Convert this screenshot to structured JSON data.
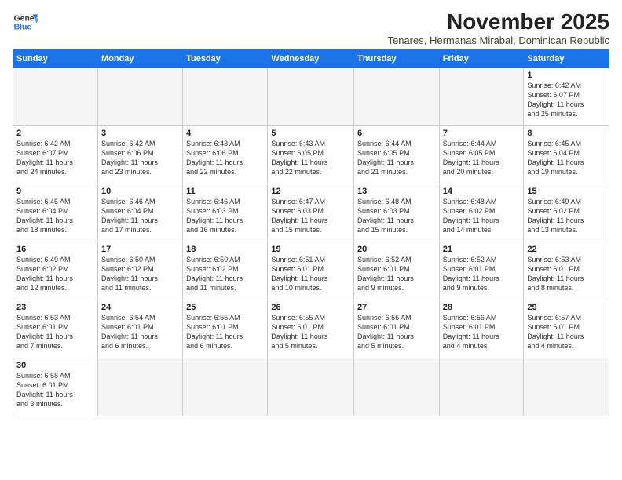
{
  "logo": {
    "line1": "General",
    "line2": "Blue"
  },
  "title": "November 2025",
  "subtitle": "Tenares, Hermanas Mirabal, Dominican Republic",
  "days_of_week": [
    "Sunday",
    "Monday",
    "Tuesday",
    "Wednesday",
    "Thursday",
    "Friday",
    "Saturday"
  ],
  "weeks": [
    [
      {
        "day": "",
        "info": ""
      },
      {
        "day": "",
        "info": ""
      },
      {
        "day": "",
        "info": ""
      },
      {
        "day": "",
        "info": ""
      },
      {
        "day": "",
        "info": ""
      },
      {
        "day": "",
        "info": ""
      },
      {
        "day": "1",
        "info": "Sunrise: 6:42 AM\nSunset: 6:07 PM\nDaylight: 11 hours\nand 25 minutes."
      }
    ],
    [
      {
        "day": "2",
        "info": "Sunrise: 6:42 AM\nSunset: 6:07 PM\nDaylight: 11 hours\nand 24 minutes."
      },
      {
        "day": "3",
        "info": "Sunrise: 6:42 AM\nSunset: 6:06 PM\nDaylight: 11 hours\nand 23 minutes."
      },
      {
        "day": "4",
        "info": "Sunrise: 6:43 AM\nSunset: 6:06 PM\nDaylight: 11 hours\nand 22 minutes."
      },
      {
        "day": "5",
        "info": "Sunrise: 6:43 AM\nSunset: 6:05 PM\nDaylight: 11 hours\nand 22 minutes."
      },
      {
        "day": "6",
        "info": "Sunrise: 6:44 AM\nSunset: 6:05 PM\nDaylight: 11 hours\nand 21 minutes."
      },
      {
        "day": "7",
        "info": "Sunrise: 6:44 AM\nSunset: 6:05 PM\nDaylight: 11 hours\nand 20 minutes."
      },
      {
        "day": "8",
        "info": "Sunrise: 6:45 AM\nSunset: 6:04 PM\nDaylight: 11 hours\nand 19 minutes."
      }
    ],
    [
      {
        "day": "9",
        "info": "Sunrise: 6:45 AM\nSunset: 6:04 PM\nDaylight: 11 hours\nand 18 minutes."
      },
      {
        "day": "10",
        "info": "Sunrise: 6:46 AM\nSunset: 6:04 PM\nDaylight: 11 hours\nand 17 minutes."
      },
      {
        "day": "11",
        "info": "Sunrise: 6:46 AM\nSunset: 6:03 PM\nDaylight: 11 hours\nand 16 minutes."
      },
      {
        "day": "12",
        "info": "Sunrise: 6:47 AM\nSunset: 6:03 PM\nDaylight: 11 hours\nand 15 minutes."
      },
      {
        "day": "13",
        "info": "Sunrise: 6:48 AM\nSunset: 6:03 PM\nDaylight: 11 hours\nand 15 minutes."
      },
      {
        "day": "14",
        "info": "Sunrise: 6:48 AM\nSunset: 6:02 PM\nDaylight: 11 hours\nand 14 minutes."
      },
      {
        "day": "15",
        "info": "Sunrise: 6:49 AM\nSunset: 6:02 PM\nDaylight: 11 hours\nand 13 minutes."
      }
    ],
    [
      {
        "day": "16",
        "info": "Sunrise: 6:49 AM\nSunset: 6:02 PM\nDaylight: 11 hours\nand 12 minutes."
      },
      {
        "day": "17",
        "info": "Sunrise: 6:50 AM\nSunset: 6:02 PM\nDaylight: 11 hours\nand 11 minutes."
      },
      {
        "day": "18",
        "info": "Sunrise: 6:50 AM\nSunset: 6:02 PM\nDaylight: 11 hours\nand 11 minutes."
      },
      {
        "day": "19",
        "info": "Sunrise: 6:51 AM\nSunset: 6:01 PM\nDaylight: 11 hours\nand 10 minutes."
      },
      {
        "day": "20",
        "info": "Sunrise: 6:52 AM\nSunset: 6:01 PM\nDaylight: 11 hours\nand 9 minutes."
      },
      {
        "day": "21",
        "info": "Sunrise: 6:52 AM\nSunset: 6:01 PM\nDaylight: 11 hours\nand 9 minutes."
      },
      {
        "day": "22",
        "info": "Sunrise: 6:53 AM\nSunset: 6:01 PM\nDaylight: 11 hours\nand 8 minutes."
      }
    ],
    [
      {
        "day": "23",
        "info": "Sunrise: 6:53 AM\nSunset: 6:01 PM\nDaylight: 11 hours\nand 7 minutes."
      },
      {
        "day": "24",
        "info": "Sunrise: 6:54 AM\nSunset: 6:01 PM\nDaylight: 11 hours\nand 6 minutes."
      },
      {
        "day": "25",
        "info": "Sunrise: 6:55 AM\nSunset: 6:01 PM\nDaylight: 11 hours\nand 6 minutes."
      },
      {
        "day": "26",
        "info": "Sunrise: 6:55 AM\nSunset: 6:01 PM\nDaylight: 11 hours\nand 5 minutes."
      },
      {
        "day": "27",
        "info": "Sunrise: 6:56 AM\nSunset: 6:01 PM\nDaylight: 11 hours\nand 5 minutes."
      },
      {
        "day": "28",
        "info": "Sunrise: 6:56 AM\nSunset: 6:01 PM\nDaylight: 11 hours\nand 4 minutes."
      },
      {
        "day": "29",
        "info": "Sunrise: 6:57 AM\nSunset: 6:01 PM\nDaylight: 11 hours\nand 4 minutes."
      }
    ],
    [
      {
        "day": "30",
        "info": "Sunrise: 6:58 AM\nSunset: 6:01 PM\nDaylight: 11 hours\nand 3 minutes."
      },
      {
        "day": "",
        "info": ""
      },
      {
        "day": "",
        "info": ""
      },
      {
        "day": "",
        "info": ""
      },
      {
        "day": "",
        "info": ""
      },
      {
        "day": "",
        "info": ""
      },
      {
        "day": "",
        "info": ""
      }
    ]
  ]
}
